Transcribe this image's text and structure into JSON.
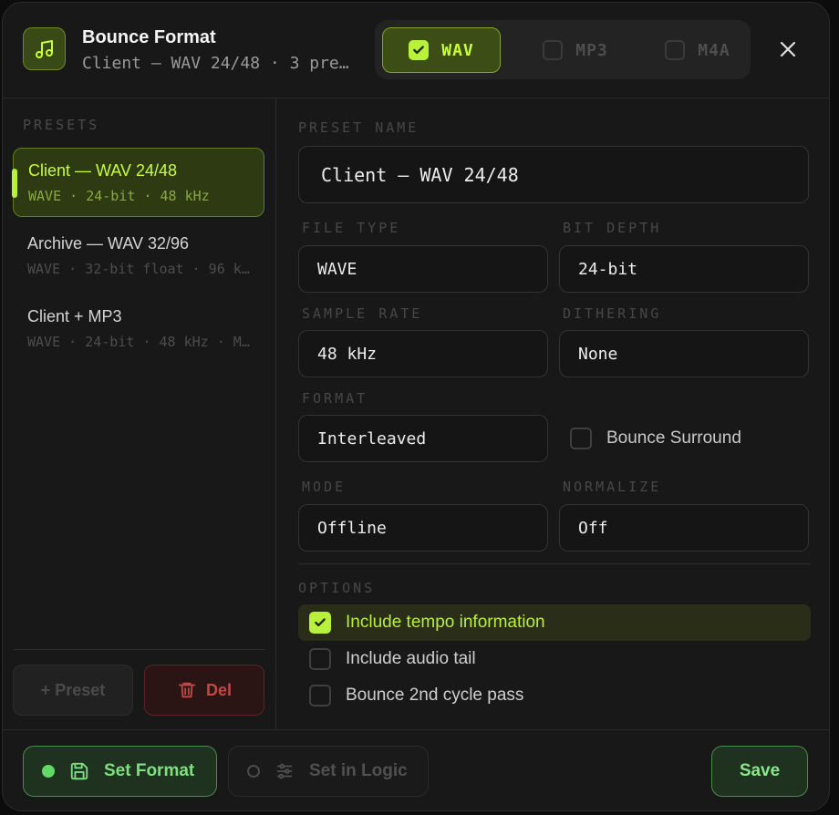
{
  "header": {
    "title": "Bounce Format",
    "subtitle": "Client — WAV 24/48 · 3 presets",
    "formats": [
      {
        "label": "WAV",
        "checked": true
      },
      {
        "label": "MP3",
        "checked": false
      },
      {
        "label": "M4A",
        "checked": false
      }
    ],
    "icons": {
      "app": "music-note-icon",
      "close": "close-icon"
    }
  },
  "sidebar": {
    "section_label": "PRESETS",
    "presets": [
      {
        "name": "Client — WAV 24/48",
        "meta": "WAVE · 24-bit · 48 kHz",
        "selected": true
      },
      {
        "name": "Archive — WAV 32/96",
        "meta": "WAVE · 32-bit float · 96 kHz",
        "selected": false
      },
      {
        "name": "Client + MP3",
        "meta": "WAVE · 24-bit · 48 kHz · MP3",
        "selected": false
      }
    ],
    "add_preset_label": "+ Preset",
    "delete_label": "Del"
  },
  "main": {
    "preset_name_label": "PRESET NAME",
    "preset_name_value": "Client — WAV 24/48",
    "file_type_label": "FILE TYPE",
    "file_type_value": "WAVE",
    "bit_depth_label": "BIT DEPTH",
    "bit_depth_value": "24-bit",
    "sample_rate_label": "SAMPLE RATE",
    "sample_rate_value": "48 kHz",
    "dithering_label": "DITHERING",
    "dithering_value": "None",
    "format_label": "FORMAT",
    "format_value": "Interleaved",
    "bounce_surround_label": "Bounce Surround",
    "bounce_surround_checked": false,
    "mode_label": "MODE",
    "mode_value": "Offline",
    "normalize_label": "NORMALIZE",
    "normalize_value": "Off",
    "options_label": "OPTIONS",
    "options": [
      {
        "label": "Include tempo information",
        "checked": true
      },
      {
        "label": "Include audio tail",
        "checked": false
      },
      {
        "label": "Bounce 2nd cycle pass",
        "checked": false
      }
    ]
  },
  "footer": {
    "set_format_label": "Set Format",
    "set_in_logic_label": "Set in Logic",
    "save_label": "Save"
  },
  "colors": {
    "accent": "#b9f03a",
    "success": "#62d966",
    "danger": "#c24848",
    "background": "#181818"
  }
}
